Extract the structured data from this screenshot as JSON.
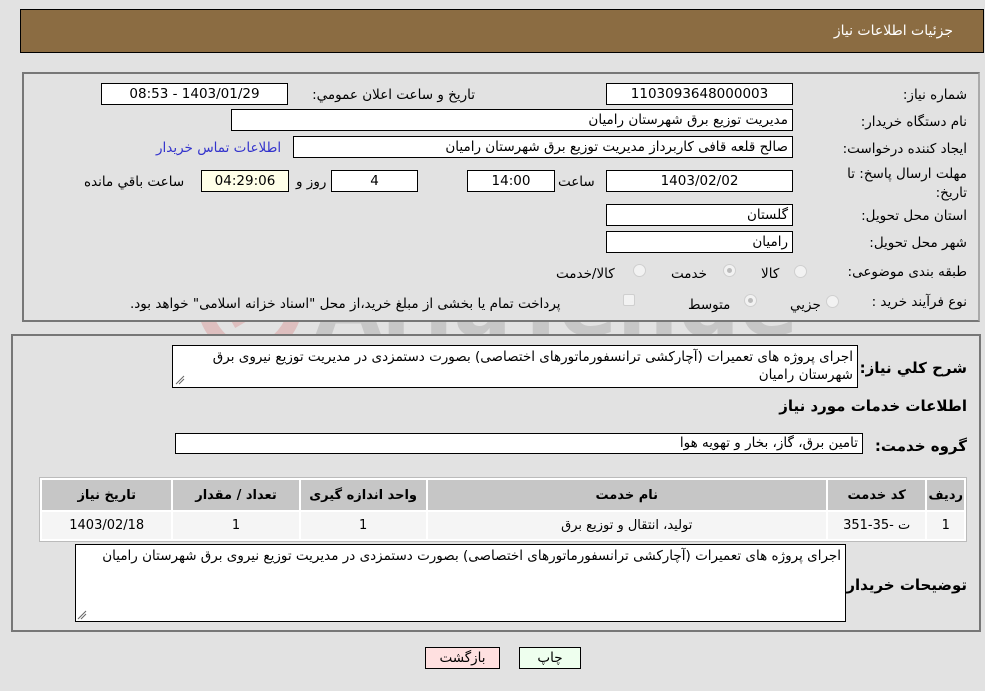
{
  "header": {
    "title": "جزئیات اطلاعات نیاز"
  },
  "form": {
    "need_number_label": "شماره نیاز:",
    "need_number": "1103093648000003",
    "announce_label": "تاریخ و ساعت اعلان عمومي:",
    "announce_value": "1403/01/29 - 08:53",
    "buyer_org_label": "نام دستگاه خریدار:",
    "buyer_org": "مدیریت توزیع برق شهرستان رامیان",
    "creator_label": "ایجاد کننده درخواست:",
    "creator": "صالح قلعه قافی کاربرداز مدیریت توزیع برق شهرستان رامیان",
    "buyer_contact_link": "اطلاعات تماس خریدار",
    "deadline_label": "مهلت ارسال پاسخ: تا تاریخ:",
    "deadline_date": "1403/02/02",
    "time_label": "ساعت",
    "deadline_time": "14:00",
    "days_value": "4",
    "days_label": "روز و",
    "remaining_time": "04:29:06",
    "remaining_label": "ساعت باقي مانده",
    "province_label": "استان محل تحویل:",
    "province": "گلستان",
    "city_label": "شهر محل تحویل:",
    "city": "رامیان",
    "category_label": "طبقه بندی موضوعی:",
    "category_options": [
      {
        "label": "کالا",
        "checked": false
      },
      {
        "label": "خدمت",
        "checked": true
      },
      {
        "label": "کالا/خدمت",
        "checked": false
      }
    ],
    "process_label": "نوع فرآیند خرید :",
    "process_options": [
      {
        "label": "جزيي",
        "checked": false
      },
      {
        "label": "متوسط",
        "checked": true
      }
    ],
    "treasury_note": "پرداخت تمام یا بخشی از مبلغ خرید،از محل \"اسناد خزانه اسلامی\" خواهد بود.",
    "treasury_checked": false
  },
  "details": {
    "summary_label": "شرح کلي نیاز:",
    "summary": "اجرای پروژه های تعمیرات (آچارکشی ترانسفورماتورهای اختصاصی)   بصورت دستمزدی در مدیریت توزیع نیروی برق شهرستان رامیان",
    "services_heading": "اطلاعات خدمات مورد نیاز",
    "service_group_label": "گروه خدمت:",
    "service_group": "تامین برق، گاز، بخار و تهویه هوا",
    "table": {
      "headers": [
        "ردیف",
        "کد خدمت",
        "نام خدمت",
        "واحد اندازه گیری",
        "تعداد / مقدار",
        "تاریخ نیاز"
      ],
      "rows": [
        [
          "1",
          "ت -35-351",
          "تولید، انتقال و توزیع برق",
          "1",
          "1",
          "1403/02/18"
        ]
      ]
    },
    "buyer_notes_label": "توضیحات خریدار:",
    "buyer_notes": "اجرای پروژه های تعمیرات (آچارکشی ترانسفورماتورهای اختصاصی)   بصورت دستمزدی در مدیریت توزیع نیروی برق شهرستان رامیان"
  },
  "buttons": {
    "print": "چاپ",
    "back": "بازگشت"
  },
  "watermark": {
    "text": "AriaTender.neT"
  }
}
